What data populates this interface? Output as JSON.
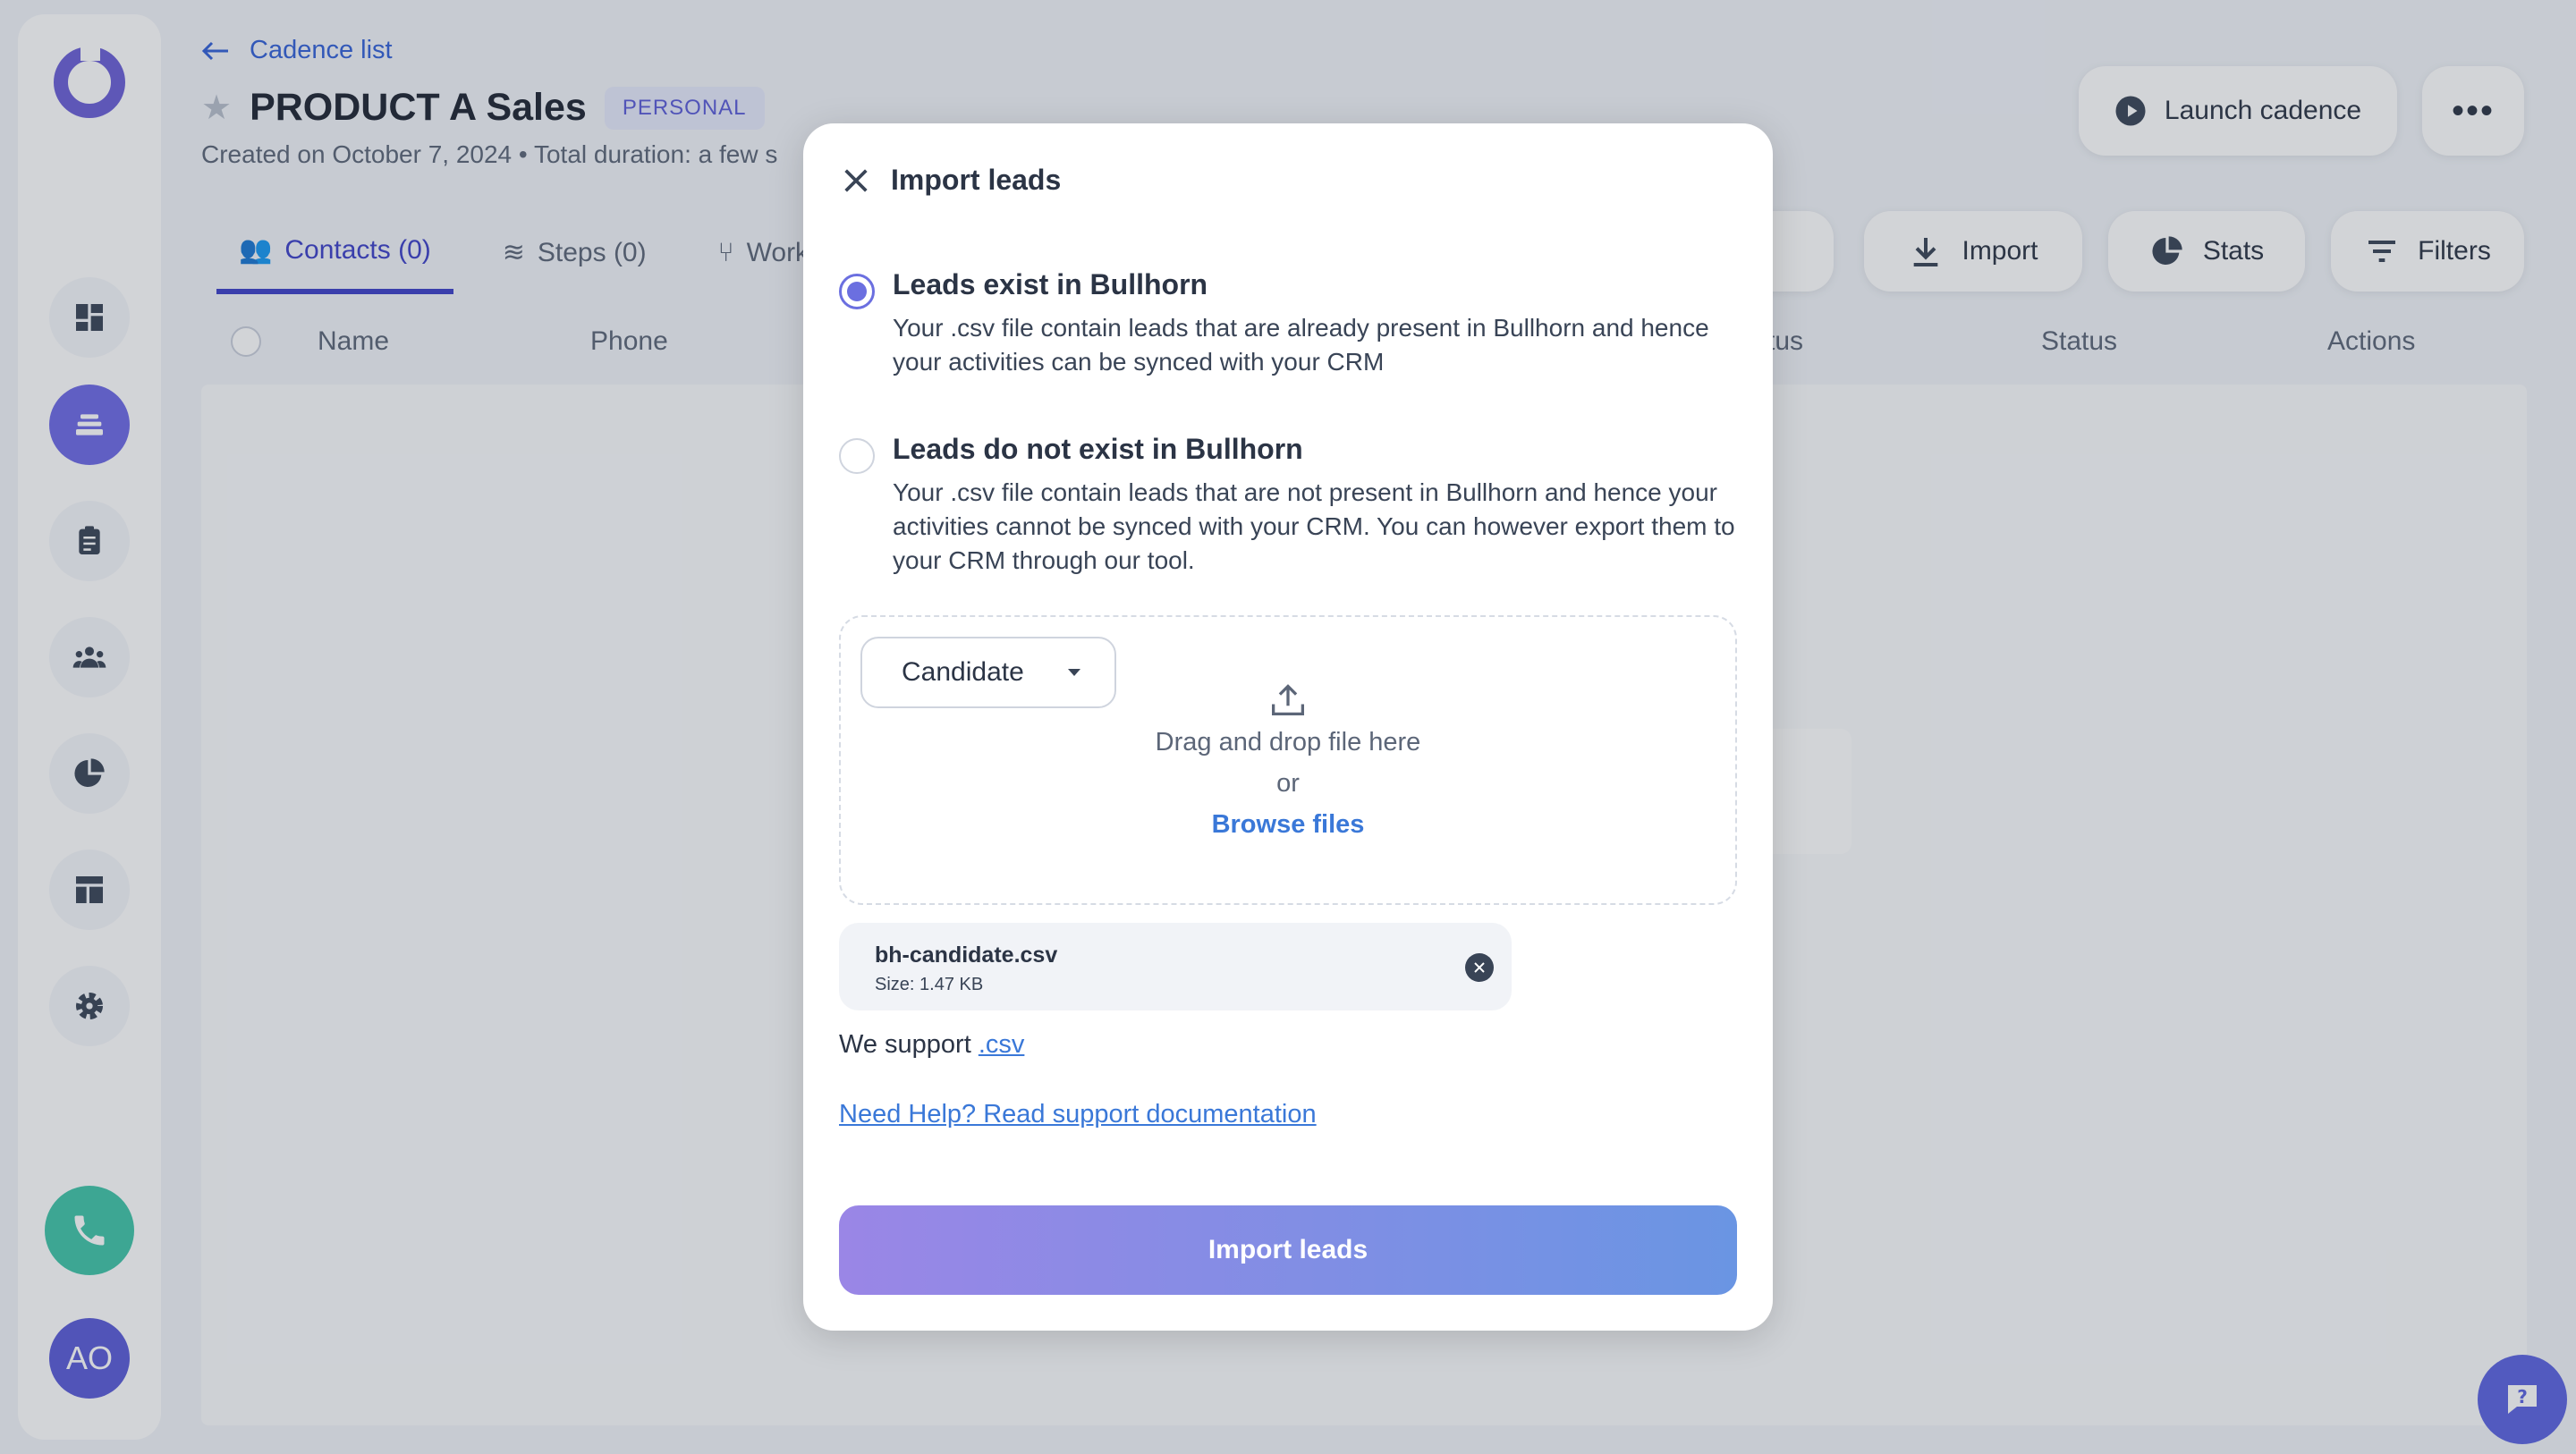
{
  "app": {
    "back_label": "Cadence list",
    "title": "PRODUCT A Sales",
    "badge": "PERSONAL",
    "subtitle": "Created on October 7, 2024 • Total duration: a few s",
    "launch_label": "Launch cadence",
    "tabs": [
      {
        "label": "Contacts (0)"
      },
      {
        "label": "Steps (0)"
      },
      {
        "label": "Workflo"
      }
    ],
    "import_label": "Import",
    "stats_label": "Stats",
    "filters_label": "Filters",
    "columns": {
      "name": "Name",
      "phone": "Phone",
      "status_partial": "tus",
      "status": "Status",
      "actions": "Actions"
    },
    "avatar_initials": "AO"
  },
  "modal": {
    "title": "Import leads",
    "options": [
      {
        "title": "Leads exist in Bullhorn",
        "description": "Your .csv file contain leads that are already present in Bullhorn and hence your activities can be synced with your CRM",
        "selected": true
      },
      {
        "title": "Leads do not exist in Bullhorn",
        "description": "Your .csv file contain leads that are not present in Bullhorn and hence your activities cannot be synced with your CRM. You can however export them to your CRM through our tool.",
        "selected": false
      }
    ],
    "select_value": "Candidate",
    "drop_text": "Drag and drop file here",
    "or_text": "or",
    "browse_label": "Browse files",
    "file": {
      "name": "bh-candidate.csv",
      "size": "Size: 1.47 KB"
    },
    "support_prefix": "We support",
    "support_format": ".csv",
    "help_link": "Need Help? Read support documentation",
    "import_button": "Import leads"
  },
  "colors": {
    "accent": "#6b6fe0",
    "link": "#3a78d8",
    "button_gradient_start": "#9a86e6",
    "button_gradient_end": "#6a95e3"
  }
}
